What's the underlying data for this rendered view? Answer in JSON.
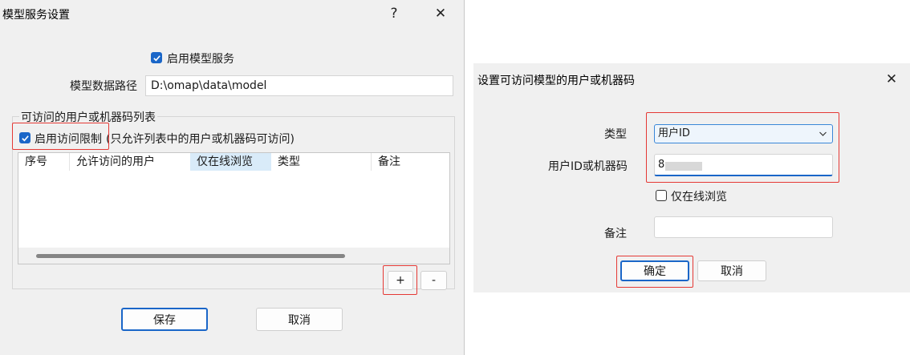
{
  "left_dialog": {
    "title": "模型服务设置",
    "help_glyph": "?",
    "close_glyph": "✕",
    "enable_service_label": "启用模型服务",
    "enable_service_checked": true,
    "model_path_label": "模型数据路径",
    "model_path_value": "D:\\omap\\data\\model",
    "group_title": "可访问的用户或机器码列表",
    "enable_restriction_label": "启用访问限制",
    "enable_restriction_note": "(只允许列表中的用户或机器码可访问)",
    "enable_restriction_checked": true,
    "columns": [
      "序号",
      "允许访问的用户",
      "仅在线浏览",
      "类型",
      "备注"
    ],
    "rows": [],
    "add_label": "+",
    "remove_label": "-",
    "save_label": "保存",
    "cancel_label": "取消"
  },
  "right_dialog": {
    "title": "设置可访问模型的用户或机器码",
    "close_glyph": "✕",
    "type_label": "类型",
    "type_selected": "用户ID",
    "id_label": "用户ID或机器码",
    "id_value": "8",
    "online_only_label": "仅在线浏览",
    "online_only_checked": false,
    "remark_label": "备注",
    "remark_value": "",
    "ok_label": "确定",
    "cancel_label": "取消"
  },
  "colors": {
    "accent": "#1a66c8",
    "highlight": "#e53935",
    "dialog_bg": "#f0f0f0",
    "selected_header": "#d9ebf9"
  }
}
